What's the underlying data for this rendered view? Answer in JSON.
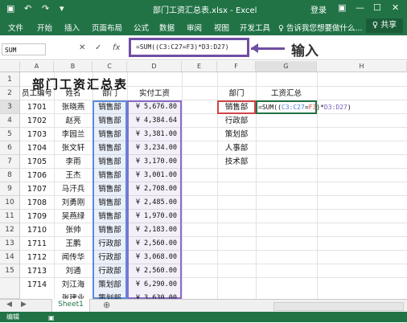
{
  "window": {
    "title": "部门工资汇总表.xlsx  -  Excel",
    "login": "登录",
    "restore_glyph": "▣",
    "minimize_glyph": "—",
    "maximize_glyph": "☐",
    "close_glyph": "✕"
  },
  "ribbon": {
    "tabs": [
      "文件",
      "开始",
      "插入",
      "页面布局",
      "公式",
      "数据",
      "审阅",
      "视图",
      "开发工具",
      "♀ 告诉我您想要做什么..."
    ],
    "share": "♀ 共享"
  },
  "formula_bar": {
    "name_box": "SUM",
    "cancel_glyph": "✕",
    "enter_glyph": "✓",
    "fx_label": "fx",
    "formula": "=SUM((C3:C27=F3)*D3:D27)",
    "callout": "输入"
  },
  "columns": [
    "A",
    "B",
    "C",
    "D",
    "E",
    "F",
    "G",
    "H"
  ],
  "rows": [
    "1",
    "2",
    "3",
    "4",
    "5",
    "6",
    "7",
    "8",
    "9",
    "10",
    "11",
    "12",
    "13",
    "14",
    "15"
  ],
  "sheet_title": "部门工资汇总表",
  "headers": {
    "a": "员工编号",
    "b": "姓名",
    "c": "部门",
    "d": "实付工资",
    "f": "部门",
    "g": "工资汇总"
  },
  "records": [
    {
      "id": "1701",
      "name": "张晓燕",
      "dept": "销售部",
      "pay": "¥ 5,676.80"
    },
    {
      "id": "1702",
      "name": "赵亮",
      "dept": "销售部",
      "pay": "¥ 4,384.64"
    },
    {
      "id": "1703",
      "name": "李园兰",
      "dept": "销售部",
      "pay": "¥ 3,381.00"
    },
    {
      "id": "1704",
      "name": "张文轩",
      "dept": "销售部",
      "pay": "¥ 3,234.00"
    },
    {
      "id": "1705",
      "name": "李雨",
      "dept": "销售部",
      "pay": "¥ 3,170.00"
    },
    {
      "id": "1706",
      "name": "王杰",
      "dept": "销售部",
      "pay": "¥ 3,001.00"
    },
    {
      "id": "1707",
      "name": "马汗兵",
      "dept": "销售部",
      "pay": "¥ 2,708.00"
    },
    {
      "id": "1708",
      "name": "刘勇刚",
      "dept": "销售部",
      "pay": "¥ 2,485.00"
    },
    {
      "id": "1709",
      "name": "吴燕绿",
      "dept": "销售部",
      "pay": "¥ 1,970.00"
    },
    {
      "id": "1710",
      "name": "张帅",
      "dept": "销售部",
      "pay": "¥ 2,183.00"
    },
    {
      "id": "1711",
      "name": "王鹏",
      "dept": "行政部",
      "pay": "¥ 2,560.00"
    },
    {
      "id": "1712",
      "name": "闻传华",
      "dept": "行政部",
      "pay": "¥ 3,068.00"
    },
    {
      "id": "1713",
      "name": "刘通",
      "dept": "行政部",
      "pay": "¥ 2,560.00"
    },
    {
      "id": "1714",
      "name": "刘江海",
      "dept": "策划部",
      "pay": "¥ 6,290.00"
    },
    {
      "id": "",
      "name": "张建业",
      "dept": "策划部",
      "pay": "¥ 3,630.00"
    }
  ],
  "departments": [
    "销售部",
    "行政部",
    "策划部",
    "人事部",
    "技术部"
  ],
  "formula_display": {
    "eq": "=SUM((",
    "range1": "C3:C27",
    "op1": "=",
    "ref": "F3",
    "op2": ")*",
    "range2": "D3:D27",
    "close": ")"
  },
  "sheet_tabs": {
    "active": "Sheet1",
    "add": "⊕"
  },
  "status": {
    "mode": "编辑"
  },
  "colors": {
    "excel_green": "#217346",
    "callout_purple": "#6f4ea4",
    "range_c_blue": "#5b8bd8",
    "range_d_purple": "#8a6cc8",
    "ref_red": "#d04545"
  }
}
